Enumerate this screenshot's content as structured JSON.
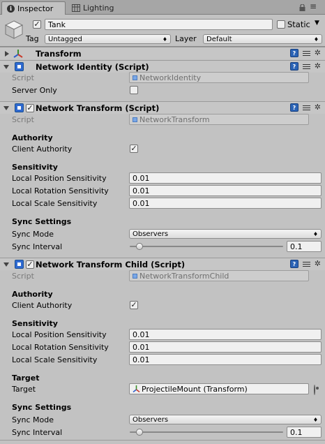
{
  "tabs": [
    {
      "label": "Inspector",
      "icon": "info-icon"
    },
    {
      "label": "Lighting",
      "icon": "lighting-icon"
    }
  ],
  "object": {
    "name": "Tank",
    "static_label": "Static",
    "tag_label": "Tag",
    "tag_value": "Untagged",
    "layer_label": "Layer",
    "layer_value": "Default"
  },
  "transform": {
    "title": "Transform"
  },
  "network_identity": {
    "title": "Network Identity (Script)",
    "script_label": "Script",
    "script_value": "NetworkIdentity",
    "server_only_label": "Server Only",
    "server_only": false
  },
  "network_transform": {
    "title": "Network Transform (Script)",
    "script_label": "Script",
    "script_value": "NetworkTransform",
    "authority_header": "Authority",
    "client_authority_label": "Client Authority",
    "client_authority": true,
    "sensitivity_header": "Sensitivity",
    "local_position_label": "Local Position Sensitivity",
    "local_position_value": "0.01",
    "local_rotation_label": "Local Rotation Sensitivity",
    "local_rotation_value": "0.01",
    "local_scale_label": "Local Scale Sensitivity",
    "local_scale_value": "0.01",
    "sync_settings_header": "Sync Settings",
    "sync_mode_label": "Sync Mode",
    "sync_mode_value": "Observers",
    "sync_interval_label": "Sync Interval",
    "sync_interval_value": "0.1"
  },
  "network_transform_child": {
    "title": "Network Transform Child (Script)",
    "script_label": "Script",
    "script_value": "NetworkTransformChild",
    "authority_header": "Authority",
    "client_authority_label": "Client Authority",
    "client_authority": true,
    "sensitivity_header": "Sensitivity",
    "local_position_label": "Local Position Sensitivity",
    "local_position_value": "0.01",
    "local_rotation_label": "Local Rotation Sensitivity",
    "local_rotation_value": "0.01",
    "local_scale_label": "Local Scale Sensitivity",
    "local_scale_value": "0.01",
    "target_header": "Target",
    "target_label": "Target",
    "target_value": "ProjectileMount (Transform)",
    "sync_settings_header": "Sync Settings",
    "sync_mode_label": "Sync Mode",
    "sync_mode_value": "Observers",
    "sync_interval_label": "Sync Interval",
    "sync_interval_value": "0.1"
  },
  "colors": {
    "background": "#c2c2c2",
    "tab_bar": "#a6a6a6",
    "script_icon": "#2f6ad1"
  }
}
